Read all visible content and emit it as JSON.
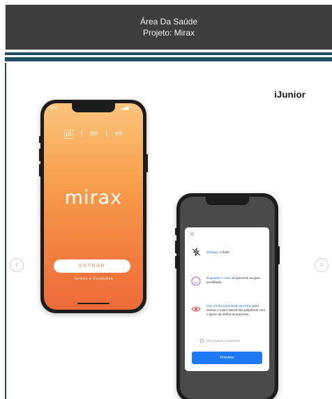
{
  "header": {
    "title": "Área Da Saúde",
    "subtitle": "Projeto: Mirax"
  },
  "brand": "iJunior",
  "carousel": {
    "prev_icon": "chevron-left-icon",
    "next_icon": "chevron-right-icon"
  },
  "phone1": {
    "time": "9:41",
    "status": "▂▄▆ ◠ ▭",
    "languages": [
      "pt",
      "en",
      "es"
    ],
    "separator": "|",
    "logo": "mirax",
    "button_label": "ENTRAR",
    "terms_label": "Termos e Condições"
  },
  "phone2": {
    "close": "✕",
    "rows": [
      {
        "icon": "flash-off-icon",
        "highlight": "Desligue",
        "text": " o flash."
      },
      {
        "icon": "face-icon",
        "highlight": "Enquadre o rosto",
        "text": " do paciente na guia pontilhada."
      },
      {
        "icon": "eye-icon",
        "highlight": "Use a linha horizontal vermelha",
        "text": " para alinhar o canto lateral das pálpebras com o ápice da orelha do paciente."
      }
    ],
    "checkbox_label": "Não mostrar novamente",
    "button_label": "Próximo"
  },
  "colors": {
    "header_bg": "#3d3d3d",
    "stripe": "#1f4e62",
    "accent_blue": "#1d7af3",
    "orange": "#f27d3e"
  }
}
